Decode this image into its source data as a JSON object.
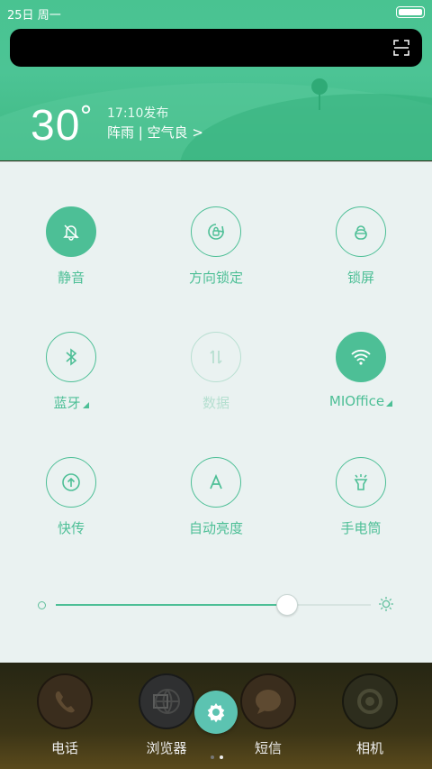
{
  "status_bar": {
    "date": "25日",
    "weekday": "周一"
  },
  "weather": {
    "temperature": "30",
    "degree_symbol": "°",
    "publish_time": "17:10发布",
    "description": "阵雨 | 空气良 >"
  },
  "quick_settings": [
    {
      "label": "静音",
      "icon": "bell-off-icon",
      "active": true
    },
    {
      "label": "方向锁定",
      "icon": "rotation-lock-icon",
      "active": false
    },
    {
      "label": "锁屏",
      "icon": "lock-icon",
      "active": false
    },
    {
      "label": "蓝牙",
      "icon": "bluetooth-icon",
      "active": false,
      "has_menu": true
    },
    {
      "label": "数据",
      "icon": "mobile-data-icon",
      "active": false,
      "disabled": true
    },
    {
      "label": "MIOffice",
      "icon": "wifi-icon",
      "active": true,
      "has_menu": true
    },
    {
      "label": "快传",
      "icon": "upload-icon",
      "active": false
    },
    {
      "label": "自动亮度",
      "icon": "auto-brightness-icon",
      "active": false
    },
    {
      "label": "手电筒",
      "icon": "flashlight-icon",
      "active": false
    }
  ],
  "brightness": {
    "level": 0.73
  },
  "dock": {
    "apps": [
      {
        "name": "电话",
        "icon": "phone-icon",
        "color": "#3a2d1d"
      },
      {
        "name": "浏览器",
        "icon": "browser-icon",
        "color": "#2f3031"
      },
      {
        "name": "短信",
        "icon": "message-icon",
        "color": "#3a2d1d"
      },
      {
        "name": "相机",
        "icon": "camera-icon",
        "color": "#2d2d1d"
      }
    ],
    "settings_icon": "gear-icon",
    "page_indicator": {
      "pages": 2,
      "current": 2
    }
  },
  "colors": {
    "accent": "#4dbf96",
    "header": "#49c391",
    "panel": "#eaf2f1"
  }
}
